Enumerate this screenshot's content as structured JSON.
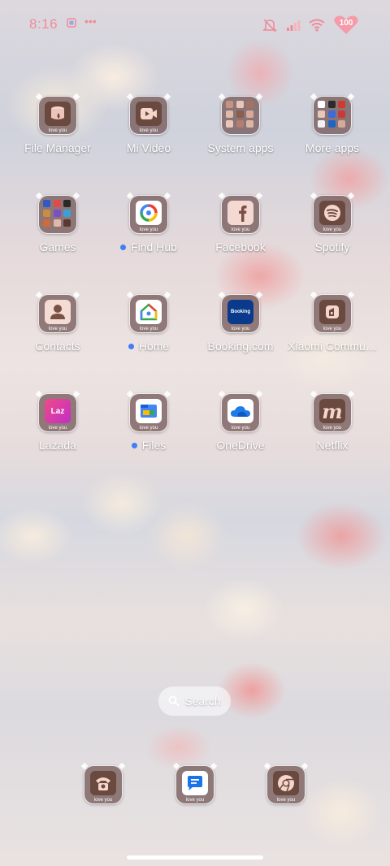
{
  "status": {
    "time": "8:16",
    "battery_level": "100"
  },
  "icon_caption": "love you",
  "apps": [
    {
      "label": "File Manager",
      "icon": "file-manager-icon",
      "dot": false
    },
    {
      "label": "Mi Video",
      "icon": "mi-video-icon",
      "dot": false
    },
    {
      "label": "System apps",
      "icon": "folder-icon",
      "dot": false
    },
    {
      "label": "More apps",
      "icon": "folder-icon",
      "dot": false
    },
    {
      "label": "Games",
      "icon": "folder-icon",
      "dot": false
    },
    {
      "label": "Find Hub",
      "icon": "find-hub-icon",
      "dot": true
    },
    {
      "label": "Facebook",
      "icon": "facebook-icon",
      "dot": false
    },
    {
      "label": "Spotify",
      "icon": "spotify-icon",
      "dot": false
    },
    {
      "label": "Contacts",
      "icon": "contacts-icon",
      "dot": false
    },
    {
      "label": "Home",
      "icon": "google-home-icon",
      "dot": true
    },
    {
      "label": "Booking.com",
      "icon": "booking-icon",
      "icon_text": "Booking",
      "dot": false
    },
    {
      "label": "Xiaomi Commu…",
      "icon": "xiaomi-community-icon",
      "dot": false
    },
    {
      "label": "Lazada",
      "icon": "lazada-icon",
      "icon_text": "Laz",
      "dot": false
    },
    {
      "label": "Files",
      "icon": "files-icon",
      "dot": true
    },
    {
      "label": "OneDrive",
      "icon": "onedrive-icon",
      "dot": false
    },
    {
      "label": "Netflix",
      "icon": "netflix-icon",
      "icon_text": "m",
      "dot": false
    }
  ],
  "search": {
    "label": "Search"
  },
  "dock": [
    {
      "icon": "phone-icon"
    },
    {
      "icon": "messages-icon"
    },
    {
      "icon": "chrome-icon"
    }
  ],
  "colors": {
    "status_pink": "#f08c9a",
    "dot_blue": "#3f7ef6"
  }
}
